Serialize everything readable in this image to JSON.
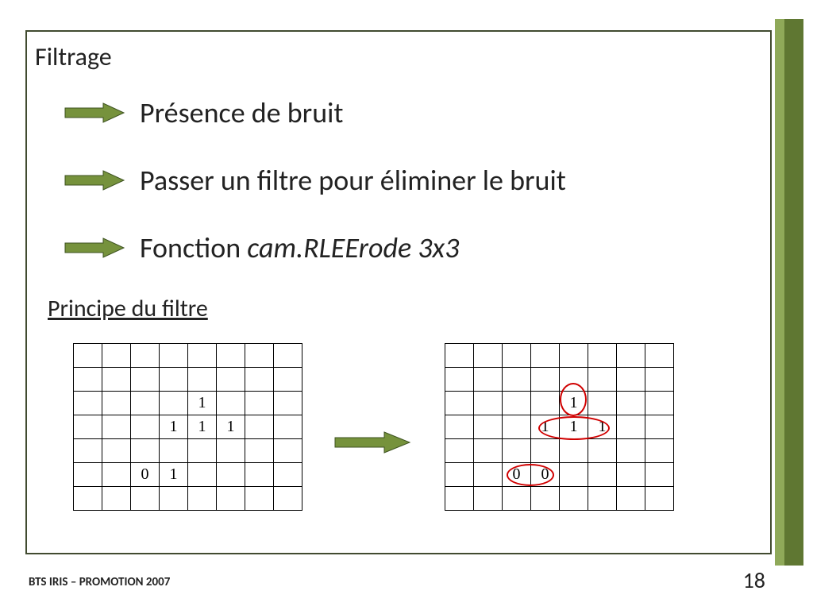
{
  "accent": "#76923c",
  "arrow_fill": "#76923c",
  "arrow_stroke": "#3d5220",
  "title": "Filtrage",
  "bullets": {
    "line1": "Présence de bruit",
    "line2": "Passer un filtre pour éliminer le bruit",
    "line3_prefix": "Fonction ",
    "line3_italic": "cam.RLEErode 3x3"
  },
  "subheading": "Principe du filtre",
  "grid_left": {
    "rows": 7,
    "cols": 8,
    "cells": {
      "2,4": "1",
      "3,3": "1",
      "3,4": "1",
      "3,5": "1",
      "5,2": "0",
      "5,3": "1"
    }
  },
  "grid_right": {
    "rows": 7,
    "cols": 8,
    "cells": {
      "2,4": "1",
      "3,3": "1",
      "3,4": "1",
      "3,5": "1",
      "5,2": "0",
      "5,3": "0"
    }
  },
  "footer": {
    "left": "BTS IRIS – PROMOTION 2007",
    "page": "18"
  }
}
